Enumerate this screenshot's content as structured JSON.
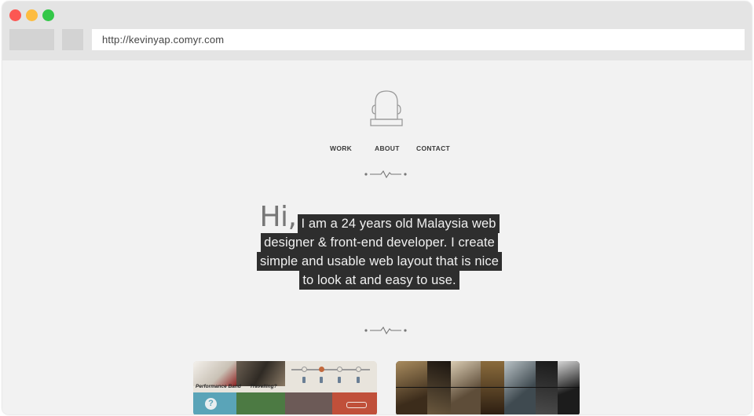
{
  "browser": {
    "url": "http://kevinyap.comyr.com"
  },
  "nav": {
    "items": [
      "WORK",
      "ABOUT",
      "CONTACT"
    ]
  },
  "hero": {
    "greeting": "Hi,",
    "lines": [
      "I am a 24 years old Malaysia web",
      "designer & front-end developer. I create",
      "simple and usable web layout that is nice",
      "to look at and easy to use."
    ]
  },
  "portfolio": {
    "card1": {
      "label_left": "Performance Band",
      "label_right": "Travelling?",
      "icon_glyph": "?"
    }
  },
  "colors": {
    "traffic_red": "#fc5753",
    "traffic_yellow": "#fdbc40",
    "traffic_green": "#33c748",
    "page_bg": "#f2f2f2",
    "highlight_bg": "#2e2e2e"
  }
}
